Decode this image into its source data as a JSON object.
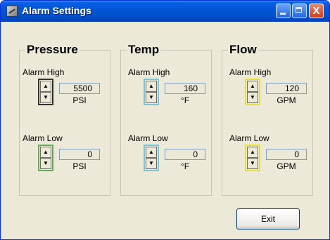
{
  "window": {
    "title": "Alarm Settings",
    "close_symbol": "X"
  },
  "groups": [
    {
      "title": "Pressure",
      "high": {
        "label": "Alarm High",
        "value": "5500",
        "unit": "PSI"
      },
      "low": {
        "label": "Alarm Low",
        "value": "0",
        "unit": "PSI"
      },
      "color": "#66aa55"
    },
    {
      "title": "Temp",
      "high": {
        "label": "Alarm High",
        "value": "160",
        "unit": "°F"
      },
      "low": {
        "label": "Alarm Low",
        "value": "0",
        "unit": "°F"
      },
      "color": "#7cc6dc"
    },
    {
      "title": "Flow",
      "high": {
        "label": "Alarm High",
        "value": "120",
        "unit": "GPM"
      },
      "low": {
        "label": "Alarm Low",
        "value": "0",
        "unit": "GPM"
      },
      "color": "#e8e03a"
    }
  ],
  "spin_arrows": {
    "up": "▲",
    "down": "▼"
  },
  "exit_button": {
    "label": "Exit"
  }
}
